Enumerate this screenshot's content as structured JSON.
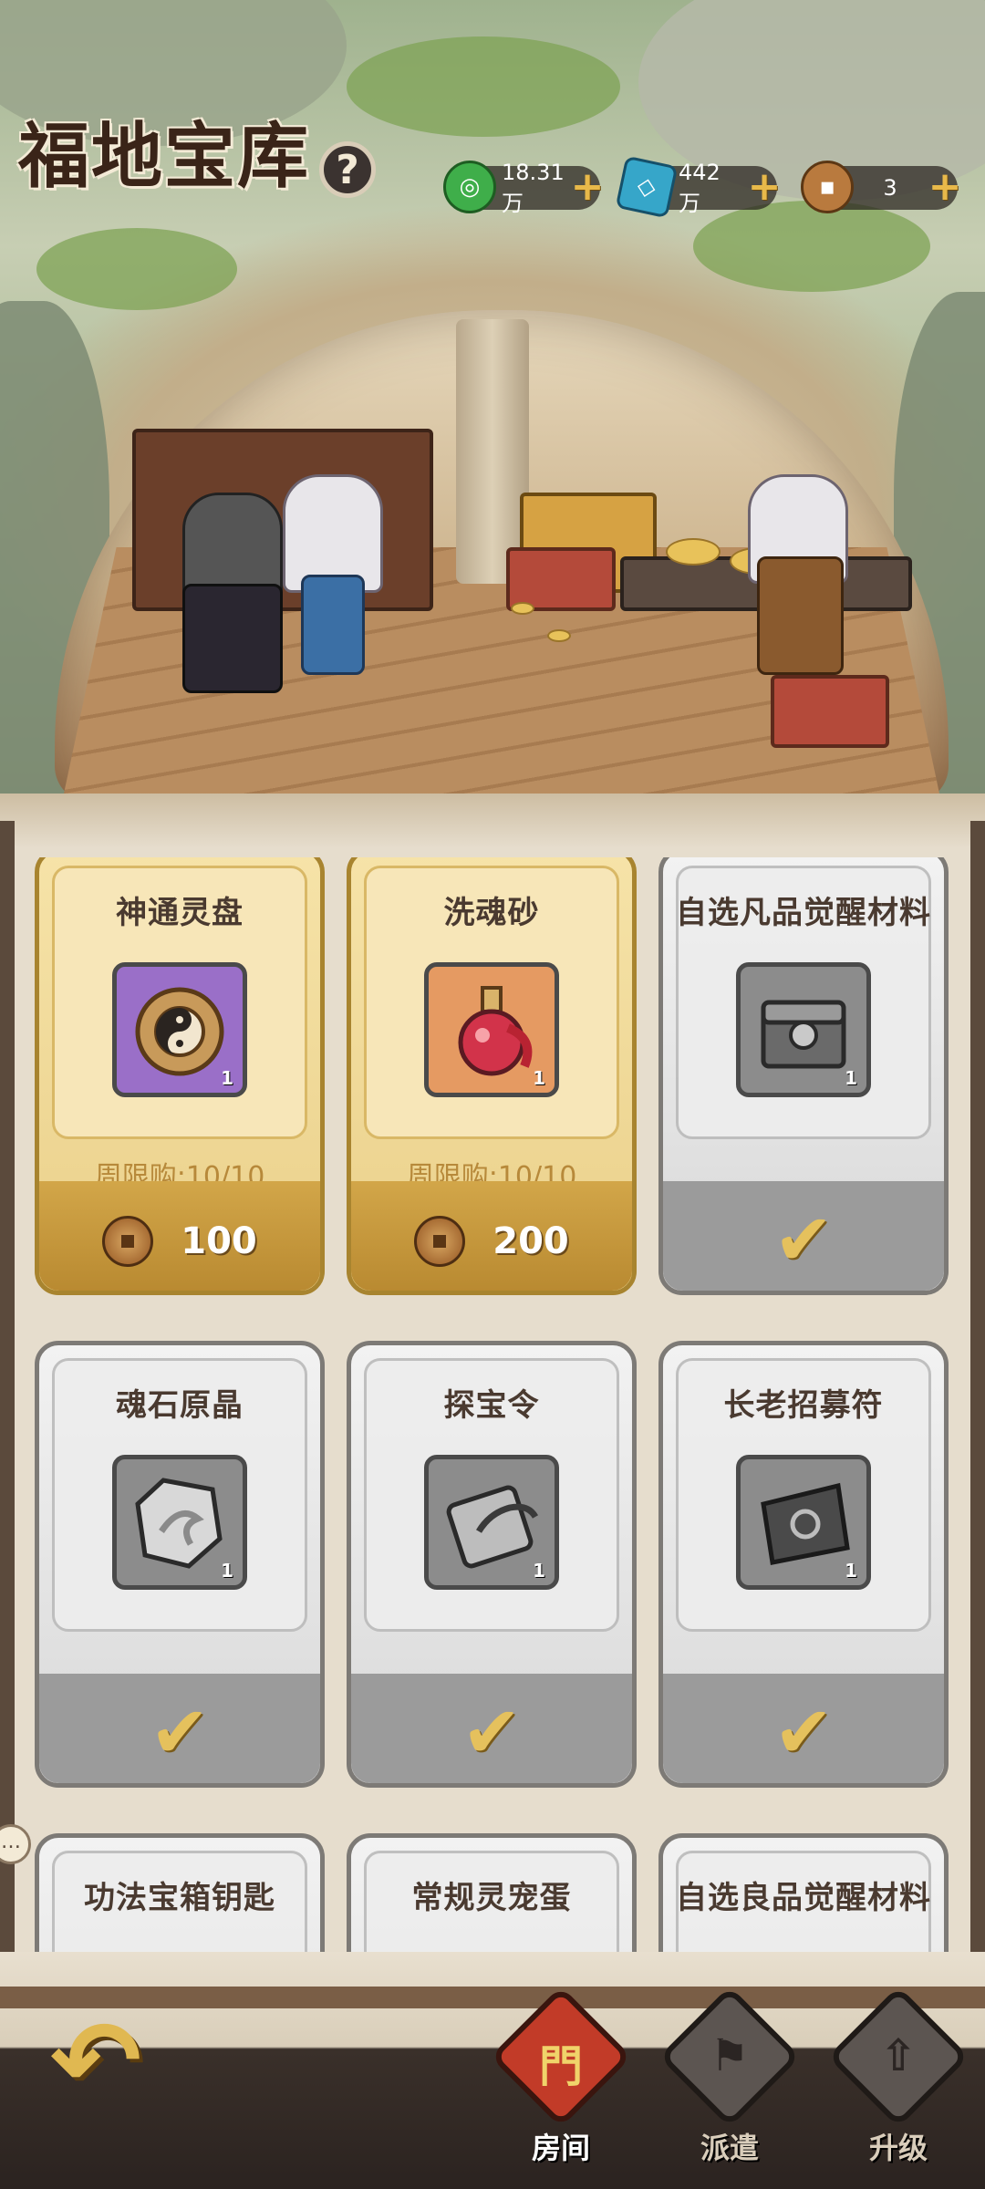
{
  "header": {
    "title": "福地宝库",
    "help_glyph": "?",
    "currencies": [
      {
        "icon": "jade-coin-icon",
        "value": "18.31万",
        "color": "#3fae4a"
      },
      {
        "icon": "spirit-crystal-icon",
        "value": "442万",
        "color": "#36a6c9"
      },
      {
        "icon": "copper-coin-icon",
        "value": "3",
        "color": "#b97a3e"
      }
    ],
    "plus_glyph": "+"
  },
  "shop": {
    "items": [
      {
        "name": "神通灵盘",
        "qty": "1",
        "limit": "周限购:10/10",
        "price": "100",
        "state": "available",
        "icon": "spirit-disc-icon",
        "icon_bg": "#9a6fc8"
      },
      {
        "name": "洗魂砂",
        "qty": "1",
        "limit": "周限购:10/10",
        "price": "200",
        "state": "available",
        "icon": "soul-sand-potion-icon",
        "icon_bg": "#e59a62"
      },
      {
        "name": "自选凡品觉醒材料",
        "qty": "1",
        "state": "owned",
        "icon": "treasure-chest-icon",
        "icon_bg": "#8c8c8c"
      },
      {
        "name": "魂石原晶",
        "qty": "1",
        "state": "owned",
        "icon": "soul-crystal-icon",
        "icon_bg": "#8c8c8c"
      },
      {
        "name": "探宝令",
        "qty": "1",
        "state": "owned",
        "icon": "treasure-token-icon",
        "icon_bg": "#8c8c8c"
      },
      {
        "name": "长老招募符",
        "qty": "1",
        "state": "owned",
        "icon": "recruit-talisman-icon",
        "icon_bg": "#8c8c8c"
      },
      {
        "name": "功法宝箱钥匙",
        "state": "owned"
      },
      {
        "name": "常规灵宠蛋",
        "state": "owned"
      },
      {
        "name": "自选良品觉醒材料",
        "state": "owned"
      }
    ],
    "check_glyph": "✔"
  },
  "nav": {
    "back_glyph": "↶",
    "tabs": [
      {
        "label": "房间",
        "glyph": "門",
        "active": true
      },
      {
        "label": "派遣",
        "glyph": "⚑",
        "active": false
      },
      {
        "label": "升级",
        "glyph": "⇧",
        "active": false
      }
    ]
  },
  "chat_glyph": "…"
}
